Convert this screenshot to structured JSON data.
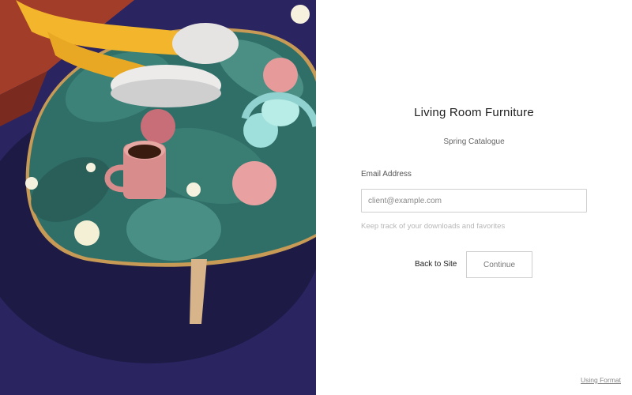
{
  "form": {
    "title": "Living Room Furniture",
    "subtitle": "Spring Catalogue",
    "email_label": "Email Address",
    "email_placeholder": "client@example.com",
    "email_value": "",
    "hint": "Keep track of your downloads and favorites",
    "back_label": "Back to Site",
    "continue_label": "Continue"
  },
  "footer": {
    "credit_link": "Using Format"
  },
  "colors": {
    "floor": "#2a2560",
    "table_top": "#2f6f68",
    "accent_pink": "#e79a9a",
    "mug": "#d98c8c",
    "headphones": "#9fe0dd"
  }
}
